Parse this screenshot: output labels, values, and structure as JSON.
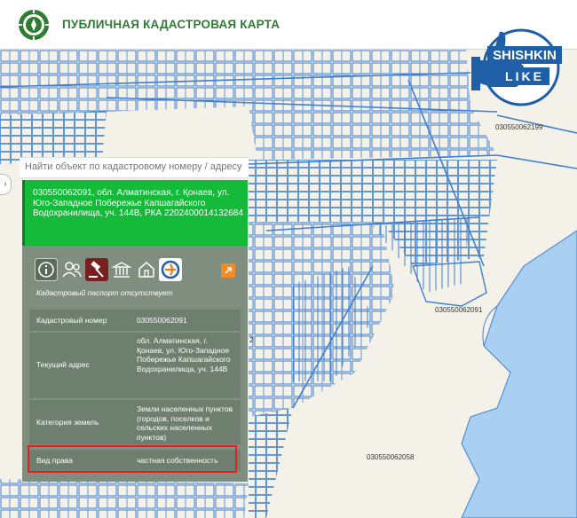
{
  "header": {
    "title": "ПУБЛИЧНАЯ КАДАСТРОВАЯ КАРТА"
  },
  "search": {
    "placeholder": "Найти объект по кадастровому номеру / адресу"
  },
  "watermark": {
    "line1": "SHISHKIN",
    "line2": "LIKE"
  },
  "map": {
    "parcel_labels": [
      "030550062199",
      "030550062091",
      "030550062058",
      "2"
    ]
  },
  "panel": {
    "header_text": "030550062091, обл. Алматинская, г. Қонаев, ул. Юго-Западное Побережье Капшагайского Водохранилища, уч. 144В, РКА 2202400014132684",
    "passport_status": "Кадастровый паспорт отсутствует",
    "rows": [
      {
        "key": "Кадастровый номер",
        "value": "030550062091"
      },
      {
        "key": "Текущий адрес",
        "value": "обл. Алматинская, г. Қонаев, ул. Юго-Западное Побережье Капшагайского Водохранилища, уч. 144В"
      },
      {
        "key": "Категория земель",
        "value": "Земли населенных пунктов (городов, поселков и сельских населенных пунктов)"
      },
      {
        "key": "Вид права",
        "value": "частная собственность"
      }
    ]
  },
  "colors": {
    "brand_green": "#2e7d32",
    "panel_header": "#16ba3a",
    "panel_body": "#7f8e7f",
    "highlight": "#e02020",
    "map_lines": "#3f7fd0",
    "water": "#a9cff2"
  },
  "icons": [
    "info-icon",
    "owners-icon",
    "gavel-icon",
    "bank-icon",
    "home-icon",
    "egov-icon",
    "external-link-icon"
  ]
}
